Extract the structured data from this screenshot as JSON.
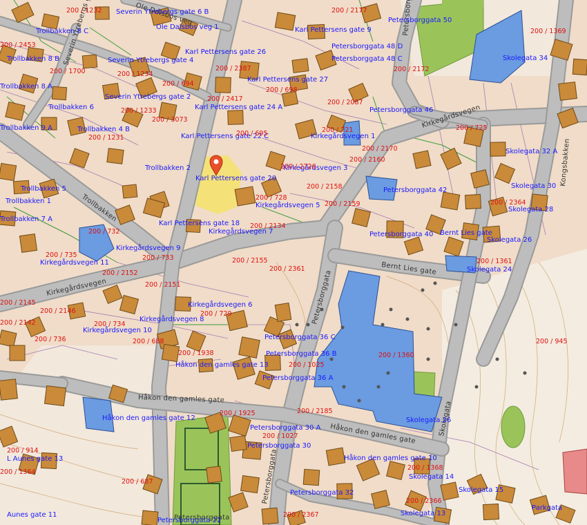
{
  "map": {
    "colors": {
      "background": "#f0dcc8",
      "road": "#9a9a9a",
      "road_fill": "#bdbdbd",
      "building": "#c98a3a",
      "public_building": "#6b9be0",
      "green": "#9ac45a",
      "highlight": "#f5e36a",
      "marker": "#e8502b",
      "address_text": "#1a1aff",
      "parcel_text": "#e01010"
    },
    "marker": {
      "name": "location-pin-icon"
    },
    "streets": [
      "Kirkegårdsvegen",
      "Kirkegårdsvegen",
      "Bernt Lies gate",
      "Håkon den gamles gate",
      "Håkon den gamles gate",
      "Trollbakken",
      "Severin Ytrebergs gate",
      "Petersborggata",
      "Petersborggata",
      "Petersborggata",
      "Skolegata",
      "Kongsbakken",
      "Ole Dalsbos veg",
      "Petersborggata"
    ],
    "addresses": [
      "Severin Ytrebergs gate 6 B",
      "Ole Dalsbos veg 1",
      "Karl Pettersens gate 9",
      "Petersborggata 50",
      "Trollbakken 8 C",
      "Karl Pettersens gate 26",
      "Severin Ytrebergs gate 4",
      "Petersborggata 48 D",
      "Petersborggata 48 C",
      "Skolegata 34",
      "Trollbakken 8 B",
      "Karl Pettersens gate 27",
      "Trollbakken 8 A",
      "Severin Ytrebergs gate 2",
      "Karl Pettersens gate 24 A",
      "Trollbakken 6",
      "Petersborggata 46",
      "Trollbakken 9 A",
      "Trollbakken 4 B",
      "Karl Pettersens gate 22 C",
      "Kirkegårdsvegen 1",
      "Skolegata 32 A",
      "Trollbakken 2",
      "Kirkegårdsvegen 3",
      "Karl Pettersens gate 20",
      "Skolegata 30",
      "Trollbakken 5",
      "Petersborggata 42",
      "Kirkegårdsvegen 5",
      "Trollbakken 7 A",
      "Skolegata 28",
      "Karl Pettersens gate 18",
      "Kirkegårdsvegen 7",
      "Petersborggata 40",
      "Bernt Lies gate",
      "Skolegata 26",
      "Kirkegårdsvegen 9",
      "Kirkegårdsvegen 11",
      "Skolegata 24",
      "Kirkegårdsvegen 6",
      "Kirkegårdsvegen 8",
      "Kirkegårdsvegen 10",
      "Petersborggata 36 C",
      "Petersborggata 36 B",
      "Håkon den gamles gate 13",
      "Petersborggata 36 A",
      "Håkon den gamles gate 12",
      "Skolegata 26",
      "Petersborggata 30 A",
      "Petersborggata 30",
      "Håkon den gamles gate 10",
      "L Aunes gate 13",
      "Skolegata 14",
      "Petersborggata 32",
      "Skolegata 15",
      "Aunes gate 11",
      "Skolegata 13",
      "Petersborggata 22",
      "Parkgata",
      "Trollbakken 1"
    ],
    "parcels": [
      "200 / 1232",
      "200 / 2177",
      "200 / 1234",
      "200 / 2172",
      "200 / 1369",
      "200 / 2387",
      "200 / 698",
      "200 / 694",
      "200 / 2417",
      "200 / 2087",
      "200 / 1233",
      "200 / 3073",
      "200 / 1231",
      "200 / 695",
      "200 / 721",
      "200 / 725",
      "200 / 2170",
      "200 / 2160",
      "200 / 2726",
      "200 / 2158",
      "200 / 728",
      "200 / 2159",
      "200 / 2134",
      "200 / 732",
      "200 / 735",
      "200 / 733",
      "200 / 2155",
      "200 / 2361",
      "200 / 2152",
      "200 / 2145",
      "200 / 2151",
      "200 / 2146",
      "200 / 729",
      "200 / 734",
      "200 / 2142",
      "200 / 736",
      "200 / 688",
      "200 / 1938",
      "200 / 1025",
      "200 / 1360",
      "200 / 945",
      "200 / 2185",
      "200 / 1925",
      "200 / 1027",
      "200 / 914",
      "200 / 687",
      "200 / 1368",
      "200 / 2366",
      "200 / 1361",
      "200 / 1364",
      "200 / 2453",
      "200 / 1700",
      "200 / 2364",
      "200 / 2367"
    ]
  }
}
